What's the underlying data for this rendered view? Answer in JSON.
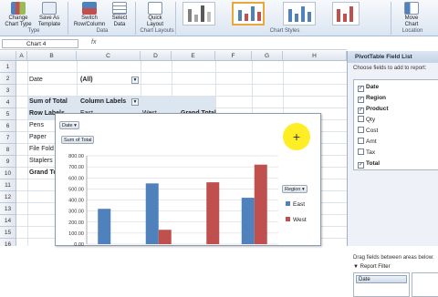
{
  "ribbon": {
    "buttons": [
      {
        "label1": "Change",
        "label2": "Chart Type"
      },
      {
        "label1": "Save As",
        "label2": "Template"
      },
      {
        "label1": "Switch",
        "label2": "Row/Column"
      },
      {
        "label1": "Select",
        "label2": "Data"
      },
      {
        "label1": "Quick",
        "label2": "Layout"
      },
      {
        "label1": "Move",
        "label2": "Chart"
      }
    ],
    "groups": {
      "type": "Type",
      "data": "Data",
      "layouts": "Chart Layouts",
      "styles": "Chart Styles",
      "location": "Location"
    },
    "accent": "#e8a93a"
  },
  "formula_bar": {
    "name_box": "Chart 4",
    "fx": "fx"
  },
  "grid": {
    "columns": [
      "A",
      "B",
      "C",
      "D",
      "E",
      "F",
      "G",
      "H"
    ],
    "rows": [
      "1",
      "2",
      "3",
      "4",
      "5",
      "6",
      "7",
      "8",
      "9",
      "10",
      "11",
      "12",
      "13",
      "14",
      "15",
      "16"
    ],
    "filter_label": "Date",
    "filter_value": "(All)",
    "sum_label": "Sum of Total",
    "column_labels": "Column Labels",
    "row_labels": "Row Labels",
    "col_east": "East",
    "col_west": "West",
    "grand_total": "Grand Total",
    "products": [
      "Pens",
      "Paper",
      "File Fold",
      "Staplers"
    ],
    "grand_total_row": "Grand To"
  },
  "chart": {
    "field_buttons": {
      "date": "Date",
      "sum": "Sum of Total",
      "region": "Region"
    },
    "legend": [
      "East",
      "West"
    ],
    "colors": {
      "east": "#4f81bd",
      "west": "#c0504d"
    }
  },
  "chart_data": {
    "type": "bar",
    "title": "",
    "xlabel": "",
    "ylabel": "",
    "ylim": [
      0,
      800
    ],
    "yticks": [
      "0.00",
      "100.00",
      "200.00",
      "300.00",
      "400.00",
      "500.00",
      "600.00",
      "700.00",
      "800.00"
    ],
    "categories": [
      "",
      "",
      "",
      ""
    ],
    "series": [
      {
        "name": "East",
        "values": [
          320,
          550,
          0,
          420
        ]
      },
      {
        "name": "West",
        "values": [
          0,
          130,
          560,
          720
        ]
      }
    ],
    "grid": true,
    "legend_position": "right"
  },
  "field_list": {
    "title": "PivotTable Field List",
    "subtitle": "Choose fields to add to report:",
    "fields": [
      {
        "name": "Date",
        "checked": true
      },
      {
        "name": "Region",
        "checked": true
      },
      {
        "name": "Product",
        "checked": true
      },
      {
        "name": "Qty",
        "checked": false
      },
      {
        "name": "Cost",
        "checked": false
      },
      {
        "name": "Amt",
        "checked": false
      },
      {
        "name": "Tax",
        "checked": false
      },
      {
        "name": "Total",
        "checked": true
      }
    ],
    "drag_hint": "Drag fields between areas below:",
    "report_filter": "Report Filter",
    "filter_item": "Date"
  }
}
